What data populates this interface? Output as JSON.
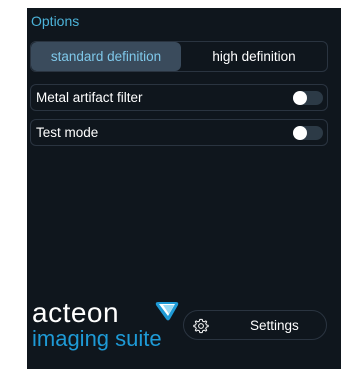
{
  "options": {
    "title": "Options",
    "definition": {
      "options": [
        "standard definition",
        "high definition"
      ],
      "selected": "standard definition"
    },
    "metal_artifact_filter": {
      "label": "Metal artifact filter",
      "enabled": false
    },
    "test_mode": {
      "label": "Test mode",
      "enabled": false
    }
  },
  "branding": {
    "line1": "acteon",
    "line2": "imaging suite",
    "mark_icon": "acteon-mark-icon"
  },
  "settings_button": {
    "label": "Settings",
    "icon": "gear-icon"
  },
  "colors": {
    "background": "#0f161d",
    "accent": "#4cb3d9",
    "selected_segment": "#3a4b5c",
    "brand_blue": "#1e9ad6"
  }
}
